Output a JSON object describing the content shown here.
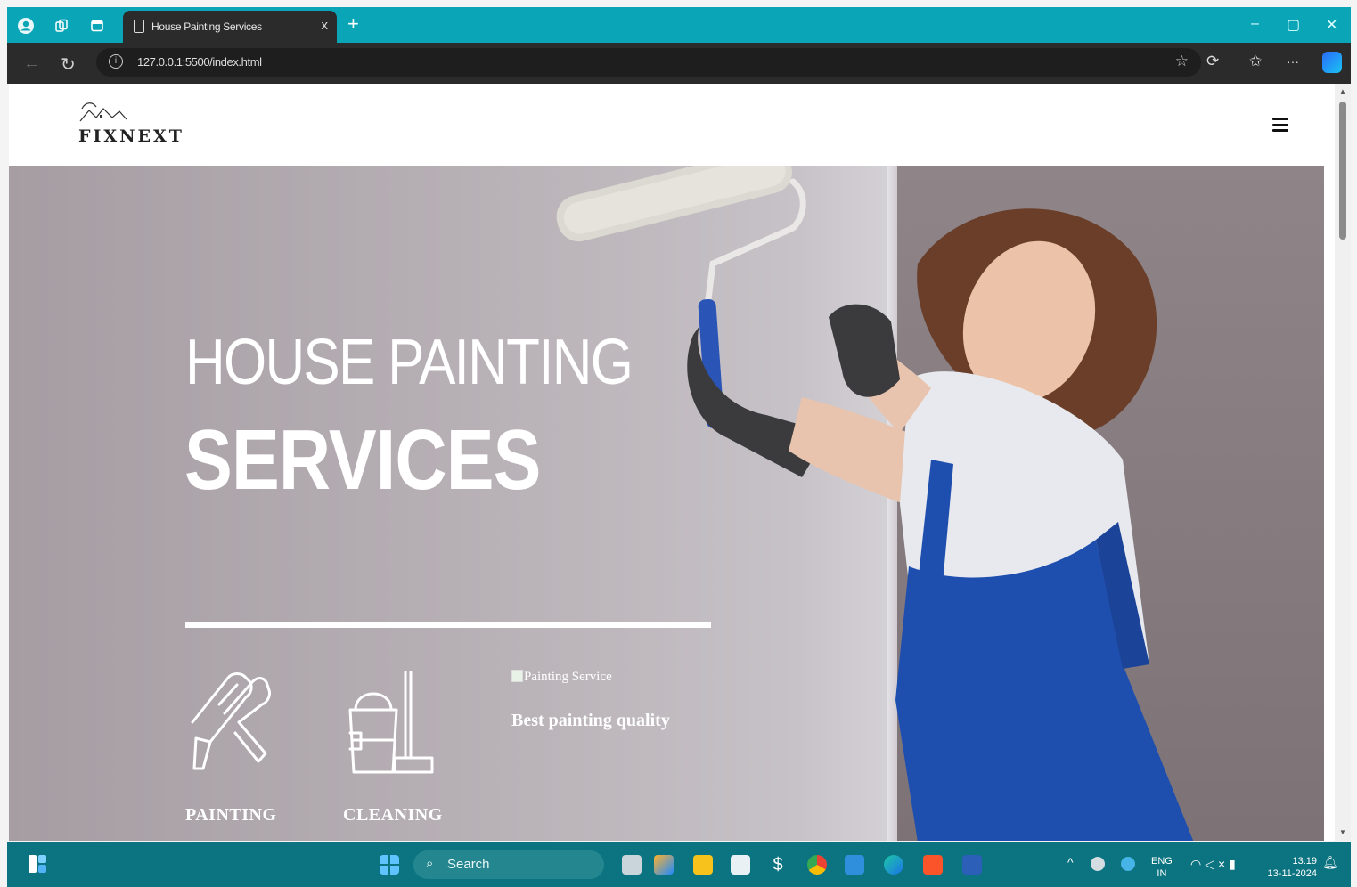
{
  "browser": {
    "tab_title": "House Painting Services",
    "tab_close": "x",
    "new_tab": "+",
    "url": "127.0.0.1:5500/index.html",
    "window_controls": {
      "minimize": "–",
      "maximize": "▢",
      "close": "✕"
    },
    "more_menu": "···"
  },
  "site": {
    "logo_text": "FIXNEXT",
    "hero": {
      "title_line_1": "HOUSE PAINTING",
      "title_line_2": "SERVICES",
      "services": [
        {
          "label": "PAINTING",
          "icon": "paint-roller-icon"
        },
        {
          "label": "CLEANING",
          "icon": "bucket-mop-icon"
        }
      ],
      "image_alt": "Painting Service",
      "tagline": "Best painting quality"
    }
  },
  "taskbar": {
    "search_label": "Search",
    "lang_line_1": "ENG",
    "lang_line_2": "IN",
    "time": "13:19",
    "date": "13-11-2024"
  },
  "colors": {
    "titlebar": "#0aa6b8",
    "taskbar": "#0c7480",
    "hero_wall": "#b7b0b5",
    "overalls": "#1f4fae"
  }
}
